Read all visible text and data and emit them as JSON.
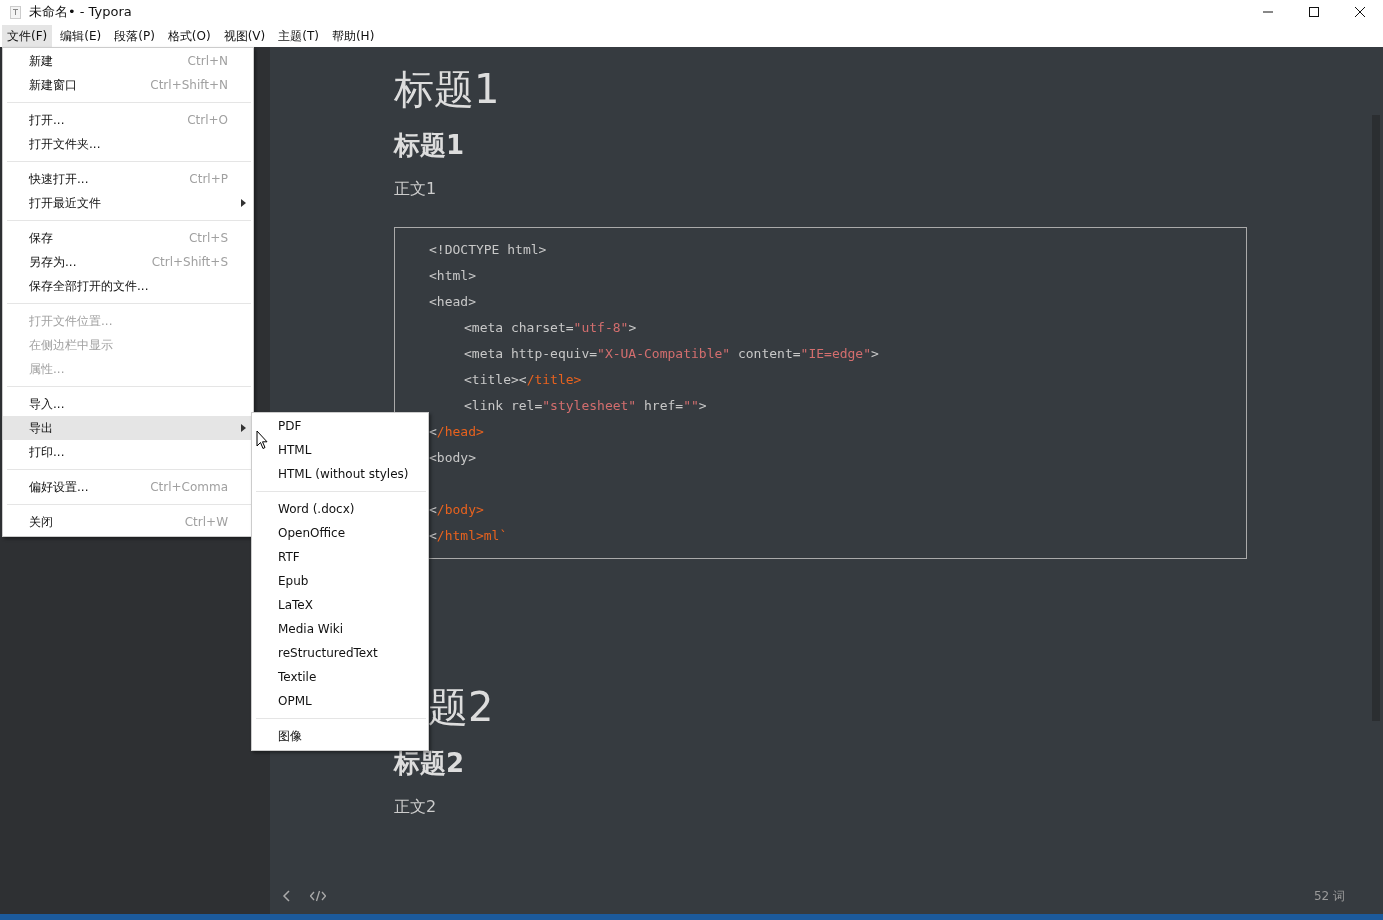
{
  "window": {
    "title": "未命名• - Typora"
  },
  "menubar": [
    {
      "label": "文件(F)",
      "selected": true
    },
    {
      "label": "编辑(E)",
      "selected": false
    },
    {
      "label": "段落(P)",
      "selected": false
    },
    {
      "label": "格式(O)",
      "selected": false
    },
    {
      "label": "视图(V)",
      "selected": false
    },
    {
      "label": "主题(T)",
      "selected": false
    },
    {
      "label": "帮助(H)",
      "selected": false
    }
  ],
  "file_menu": [
    [
      {
        "label": "新建",
        "shortcut": "Ctrl+N",
        "disabled": false,
        "submenu": false,
        "selected": false
      },
      {
        "label": "新建窗口",
        "shortcut": "Ctrl+Shift+N",
        "disabled": false,
        "submenu": false,
        "selected": false
      }
    ],
    [
      {
        "label": "打开...",
        "shortcut": "Ctrl+O",
        "disabled": false,
        "submenu": false,
        "selected": false
      },
      {
        "label": "打开文件夹...",
        "disabled": false,
        "submenu": false,
        "selected": false
      }
    ],
    [
      {
        "label": "快速打开...",
        "shortcut": "Ctrl+P",
        "disabled": false,
        "submenu": false,
        "selected": false
      },
      {
        "label": "打开最近文件",
        "disabled": false,
        "submenu": true,
        "selected": false
      }
    ],
    [
      {
        "label": "保存",
        "shortcut": "Ctrl+S",
        "disabled": false,
        "submenu": false,
        "selected": false
      },
      {
        "label": "另存为...",
        "shortcut": "Ctrl+Shift+S",
        "disabled": false,
        "submenu": false,
        "selected": false
      },
      {
        "label": "保存全部打开的文件...",
        "disabled": false,
        "submenu": false,
        "selected": false
      }
    ],
    [
      {
        "label": "打开文件位置...",
        "disabled": true,
        "submenu": false,
        "selected": false
      },
      {
        "label": "在侧边栏中显示",
        "disabled": true,
        "submenu": false,
        "selected": false
      },
      {
        "label": "属性...",
        "disabled": true,
        "submenu": false,
        "selected": false
      }
    ],
    [
      {
        "label": "导入...",
        "disabled": false,
        "submenu": false,
        "selected": false
      },
      {
        "label": "导出",
        "disabled": false,
        "submenu": true,
        "selected": true
      },
      {
        "label": "打印...",
        "disabled": false,
        "submenu": false,
        "selected": false
      }
    ],
    [
      {
        "label": "偏好设置...",
        "shortcut": "Ctrl+Comma",
        "disabled": false,
        "submenu": false,
        "selected": false
      }
    ],
    [
      {
        "label": "关闭",
        "shortcut": "Ctrl+W",
        "disabled": false,
        "submenu": false,
        "selected": false
      }
    ]
  ],
  "export_submenu": [
    [
      "PDF",
      "HTML",
      "HTML (without styles)"
    ],
    [
      "Word (.docx)",
      "OpenOffice",
      "RTF",
      "Epub",
      "LaTeX",
      "Media Wiki",
      "reStructuredText",
      "Textile",
      "OPML"
    ],
    [
      "图像"
    ]
  ],
  "document": {
    "blocks": [
      {
        "kind": "h1",
        "text": "标题1"
      },
      {
        "kind": "h2",
        "text": "标题1"
      },
      {
        "kind": "p",
        "text": "正文1"
      },
      {
        "kind": "code",
        "lines": [
          {
            "indented": false,
            "segments": [
              {
                "kind": "plain",
                "text": "<!DOCTYPE html>"
              }
            ]
          },
          {
            "indented": false,
            "segments": [
              {
                "kind": "plain",
                "text": "<html>"
              }
            ]
          },
          {
            "indented": false,
            "segments": [
              {
                "kind": "plain",
                "text": "<head>"
              }
            ]
          },
          {
            "indented": true,
            "segments": [
              {
                "kind": "plain",
                "text": "<meta charset="
              },
              {
                "kind": "string",
                "text": "\"utf-8\""
              },
              {
                "kind": "plain",
                "text": ">"
              }
            ]
          },
          {
            "indented": true,
            "segments": [
              {
                "kind": "plain",
                "text": "<meta http-equiv="
              },
              {
                "kind": "string",
                "text": "\"X-UA-Compatible\""
              },
              {
                "kind": "plain",
                "text": " content="
              },
              {
                "kind": "string",
                "text": "\"IE=edge\""
              },
              {
                "kind": "plain",
                "text": ">"
              }
            ]
          },
          {
            "indented": true,
            "segments": [
              {
                "kind": "plain",
                "text": "<title><"
              },
              {
                "kind": "close",
                "text": "/title>"
              }
            ]
          },
          {
            "indented": true,
            "segments": [
              {
                "kind": "plain",
                "text": "<link rel="
              },
              {
                "kind": "string",
                "text": "\"stylesheet\""
              },
              {
                "kind": "plain",
                "text": " href="
              },
              {
                "kind": "string",
                "text": "\"\""
              },
              {
                "kind": "plain",
                "text": ">"
              }
            ]
          },
          {
            "indented": false,
            "segments": [
              {
                "kind": "plain",
                "text": "<"
              },
              {
                "kind": "close",
                "text": "/head>"
              }
            ]
          },
          {
            "indented": false,
            "segments": [
              {
                "kind": "plain",
                "text": "<body>"
              }
            ]
          },
          {
            "kind": "blank"
          },
          {
            "indented": false,
            "segments": [
              {
                "kind": "plain",
                "text": "<"
              },
              {
                "kind": "close",
                "text": "/body>"
              }
            ]
          },
          {
            "indented": false,
            "segments": [
              {
                "kind": "plain",
                "text": "<"
              },
              {
                "kind": "close",
                "text": "/html>ml`"
              }
            ]
          }
        ]
      },
      {
        "kind": "h1",
        "text": "题2"
      },
      {
        "kind": "h2",
        "text": "标题2"
      },
      {
        "kind": "p",
        "text": "正文2"
      }
    ]
  },
  "status_bar": {
    "word_count": "52 词"
  }
}
